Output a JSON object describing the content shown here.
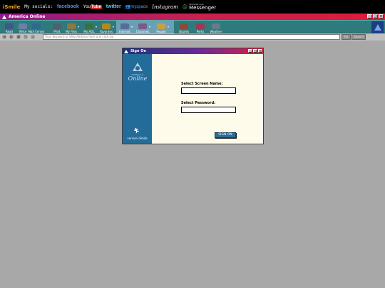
{
  "topbar": {
    "brand": "iSmile",
    "socials_label": "My socials:",
    "facebook": "facebook",
    "youtube_you": "You",
    "youtube_tube": "Tube",
    "twitter": "twitter",
    "myspace": "myspace",
    "instagram": "Instagram",
    "messenger_small": "Windows Live",
    "messenger": "Messenger"
  },
  "aol": {
    "title": "America Online",
    "toolbar": [
      {
        "label": "Read",
        "icon": "mail-read-icon",
        "color": "#3b5a8a"
      },
      {
        "label": "Write",
        "icon": "mail-write-icon",
        "color": "#6d7fa8"
      },
      {
        "label": "Mail Center",
        "icon": "mail-center-icon",
        "color": "#2e6a8f"
      },
      {
        "label": "Print",
        "icon": "printer-icon",
        "color": "#506070"
      },
      {
        "label": "My Files",
        "icon": "files-icon",
        "color": "#8a7a40"
      },
      {
        "label": "My AOL",
        "icon": "my-aol-icon",
        "color": "#3a7040"
      },
      {
        "label": "Favorites",
        "icon": "favorites-icon",
        "color": "#b08a20"
      },
      {
        "label": "Internet",
        "icon": "internet-icon",
        "color": "#5a6a9a"
      },
      {
        "label": "Channels",
        "icon": "channels-icon",
        "color": "#7a5a8a"
      },
      {
        "label": "People",
        "icon": "people-icon",
        "color": "#c8a040"
      },
      {
        "label": "Quotes",
        "icon": "quotes-icon",
        "color": "#8a4a3a"
      },
      {
        "label": "Perks",
        "icon": "perks-icon",
        "color": "#9a3a5a"
      },
      {
        "label": "Weather",
        "icon": "weather-icon",
        "color": "#6a7a8a"
      }
    ],
    "address_placeholder": "Type Keyword or Web Address here and click Go",
    "go_label": "Go",
    "search_label": "Search"
  },
  "signon": {
    "title": "Sign On",
    "screen_name_label": "Select Screen Name:",
    "password_label": "Select Password:",
    "button": "SIGN ON",
    "logo_america": "AMERICA",
    "logo_online": "Online",
    "version": "version iSmile"
  },
  "colors": {
    "desktop": "#a8a8a8",
    "toolbar": "#2f7a7c",
    "signon_panel": "#236c9a",
    "signon_bg": "#fffbea"
  }
}
